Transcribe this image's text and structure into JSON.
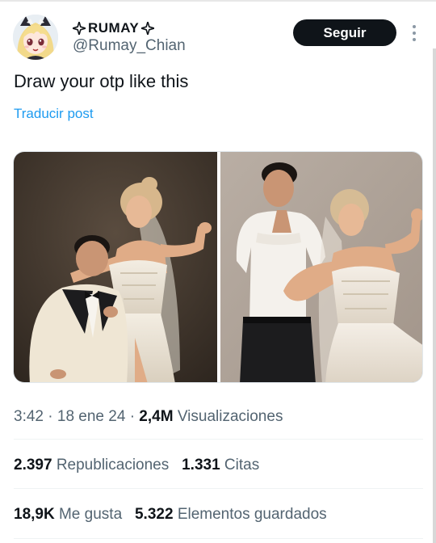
{
  "author": {
    "display_name": "RUMAY",
    "handle": "@Rumay_Chian",
    "avatar": "anime-avatar",
    "name_decoration_icon": "sparkle-icon"
  },
  "follow_button": {
    "label": "Seguir"
  },
  "more_icon": "more-vertical-icon",
  "post": {
    "text": "Draw your otp like this",
    "translate_link": "Traducir post"
  },
  "media": {
    "photos": [
      {
        "name": "photo-couple-seated"
      },
      {
        "name": "photo-couple-standing"
      }
    ]
  },
  "meta": {
    "time": "3:42",
    "sep1": "·",
    "date": "18 ene 24",
    "sep2": "·",
    "views_count": "2,4M",
    "views_label": "Visualizaciones"
  },
  "stats": {
    "reposts_count": "2.397",
    "reposts_label": "Republicaciones",
    "quotes_count": "1.331",
    "quotes_label": "Citas",
    "likes_count": "18,9K",
    "likes_label": "Me gusta",
    "bookmarks_count": "5.322",
    "bookmarks_label": "Elementos guardados"
  },
  "colors": {
    "text": "#0f1419",
    "secondary": "#536471",
    "link": "#1d9bf0",
    "button_bg": "#0f1419"
  }
}
